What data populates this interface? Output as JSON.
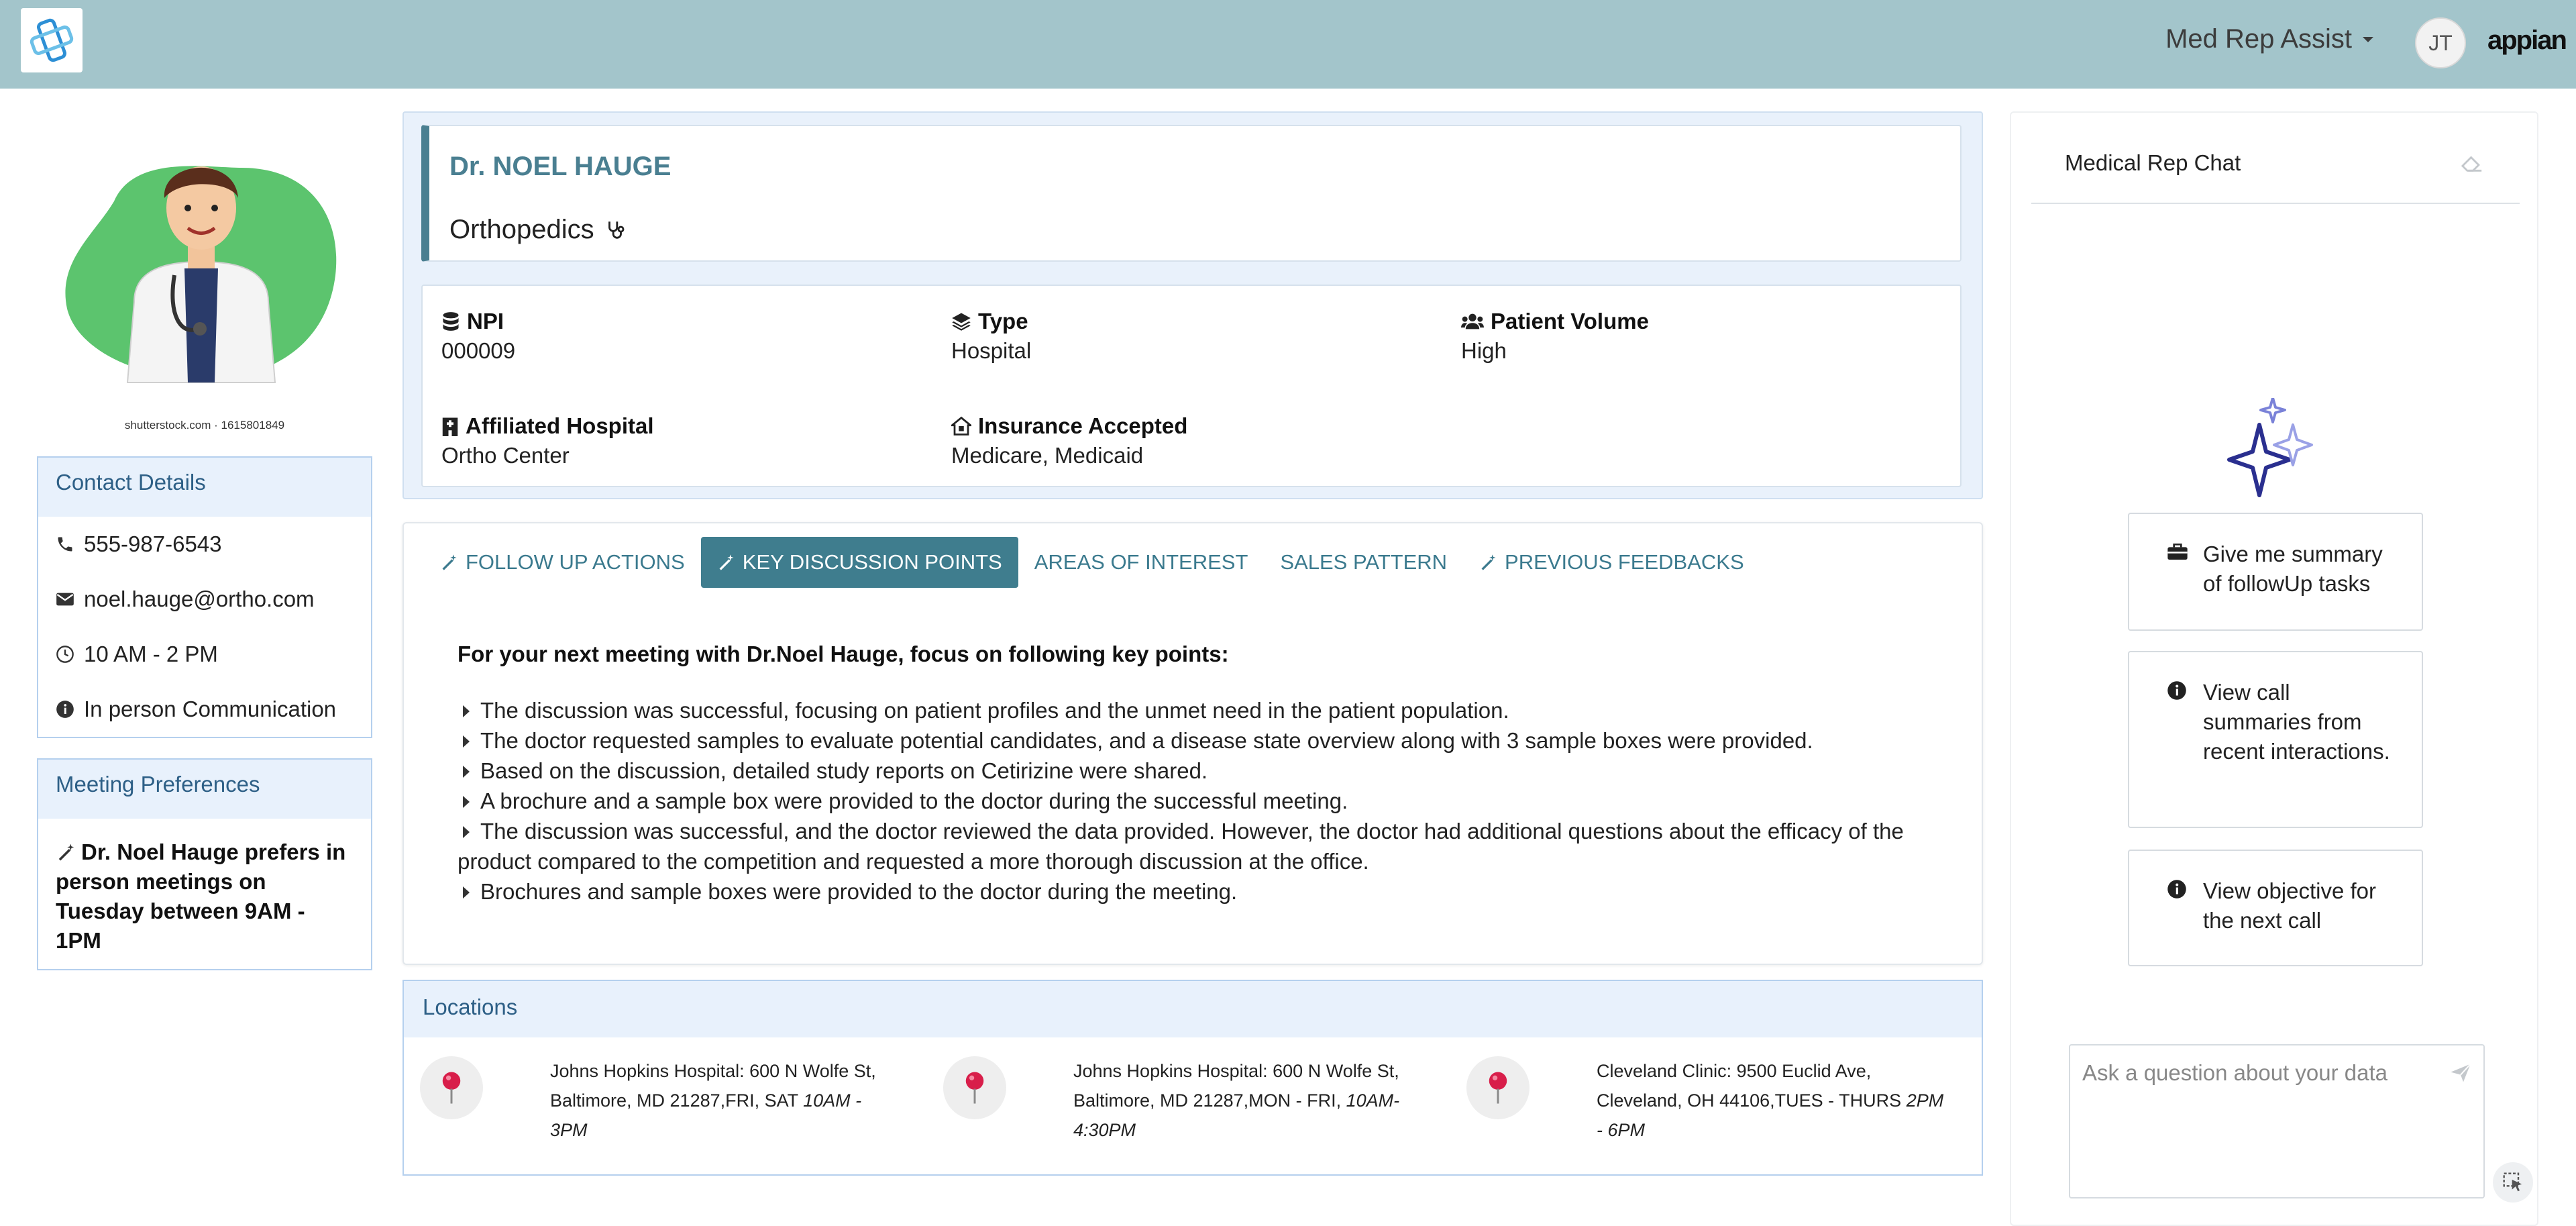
{
  "header": {
    "app_name": "Med Rep Assist",
    "user_initials": "JT",
    "brand": "appian"
  },
  "left": {
    "image_credit": "shutterstock.com · 1615801849",
    "contact": {
      "title": "Contact Details",
      "phone": "555-987-6543",
      "email": "noel.hauge@ortho.com",
      "hours": "10 AM - 2 PM",
      "mode": "In person Communication"
    },
    "preferences": {
      "title": "Meeting Preferences",
      "text": "Dr. Noel Hauge prefers in person meetings on Tuesday between 9AM - 1PM"
    }
  },
  "profile": {
    "name": "Dr. NOEL HAUGE",
    "specialty": "Orthopedics",
    "fields": [
      {
        "label": "NPI",
        "value": "000009"
      },
      {
        "label": "Type",
        "value": "Hospital"
      },
      {
        "label": "Patient Volume",
        "value": "High"
      },
      {
        "label": "Affiliated Hospital",
        "value": "Ortho Center"
      },
      {
        "label": "Insurance Accepted",
        "value": "Medicare, Medicaid"
      }
    ]
  },
  "tabs": [
    {
      "label": "FOLLOW UP ACTIONS",
      "active": false
    },
    {
      "label": "KEY DISCUSSION POINTS",
      "active": true
    },
    {
      "label": "AREAS OF INTEREST",
      "active": false
    },
    {
      "label": "SALES PATTERN",
      "active": false
    },
    {
      "label": "PREVIOUS FEEDBACKS",
      "active": false
    }
  ],
  "key_points": {
    "title": "For your next meeting with Dr.Noel Hauge, focus on following key points:",
    "items": [
      "The discussion was successful, focusing on patient profiles and the unmet need in the patient population.",
      "The doctor requested samples to evaluate potential candidates, and a disease state overview along with 3 sample boxes were provided.",
      "Based on the discussion, detailed study reports on Cetirizine were shared.",
      "A brochure and a sample box were provided to the doctor during the successful meeting.",
      "The discussion was successful, and the doctor reviewed the data provided. However, the doctor had additional questions about the efficacy of the product compared to the competition and requested a more thorough discussion at the office.",
      "Brochures and sample boxes were provided to the doctor during the meeting."
    ]
  },
  "locations": {
    "title": "Locations",
    "items": [
      {
        "address": "Johns Hopkins Hospital: 600 N Wolfe St, Baltimore, MD 21287,FRI, SAT ",
        "time": "10AM - 3PM"
      },
      {
        "address": "Johns Hopkins Hospital: 600 N Wolfe St, Baltimore, MD 21287,MON - FRI, ",
        "time": "10AM-4:30PM"
      },
      {
        "address": "Cleveland Clinic: 9500 Euclid Ave, Cleveland, OH 44106,TUES - THURS ",
        "time": "2PM - 6PM"
      }
    ]
  },
  "chat": {
    "title": "Medical Rep Chat",
    "suggestions": [
      "Give me summary of followUp tasks",
      "View call summaries from recent interactions.",
      "View objective for the next call"
    ],
    "input_placeholder": "Ask a question about your data"
  },
  "colors": {
    "header_bg": "#a3c5cb",
    "accent": "#3f7d8e",
    "pin": "#d81e4a"
  }
}
